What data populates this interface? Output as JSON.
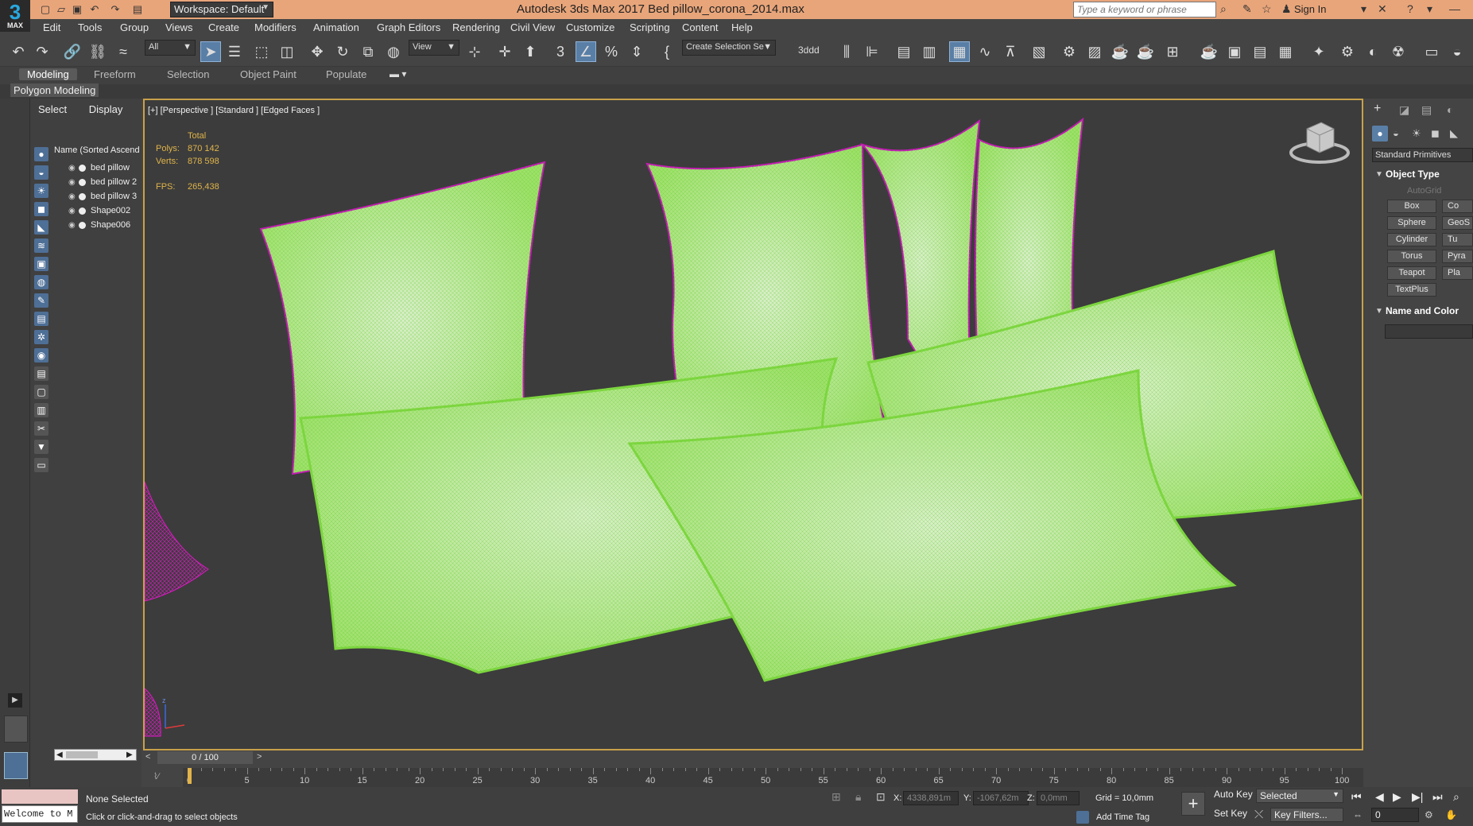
{
  "app": {
    "logo_text": "3",
    "logo_sub": "MAX",
    "title": "Autodesk 3ds Max 2017     Bed pillow_corona_2014.max",
    "workspace": "Workspace: Default",
    "search_placeholder": "Type a keyword or phrase",
    "sign_in": "Sign In"
  },
  "menu": [
    "Edit",
    "Tools",
    "Group",
    "Views",
    "Create",
    "Modifiers",
    "Animation",
    "Graph Editors",
    "Rendering",
    "Civil View",
    "Customize",
    "Scripting",
    "Content",
    "Help"
  ],
  "toolbar": {
    "filter": "All",
    "view_ref": "View",
    "selection_set": "Create Selection Se",
    "named": "3ddd"
  },
  "ribbon": {
    "tabs": [
      "Modeling",
      "Freeform",
      "Selection",
      "Object Paint",
      "Populate"
    ],
    "panel": "Polygon Modeling"
  },
  "scene_explorer": {
    "tabs": [
      "Select",
      "Display"
    ],
    "header": "Name (Sorted Ascend",
    "objects": [
      "bed pillow",
      "bed pillow 2",
      "bed pillow 3",
      "Shape002",
      "Shape006"
    ]
  },
  "viewport": {
    "label": "[+] [Perspective ] [Standard ] [Edged Faces ]",
    "stats_header": "Total",
    "polys_label": "Polys:",
    "polys": "870 142",
    "verts_label": "Verts:",
    "verts": "878 598",
    "fps_label": "FPS:",
    "fps": "265,438"
  },
  "command_panel": {
    "dropdown": "Standard Primitives",
    "object_type": "Object Type",
    "autogrid": "AutoGrid",
    "buttons_left": [
      "Box",
      "Sphere",
      "Cylinder",
      "Torus",
      "Teapot",
      "TextPlus"
    ],
    "buttons_right": [
      "Co",
      "GeoS",
      "Tu",
      "Pyra",
      "Pla"
    ],
    "name_and_color": "Name and Color"
  },
  "timeline": {
    "frame": "0 / 100",
    "ticks": [
      "0",
      "5",
      "10",
      "15",
      "20",
      "25",
      "30",
      "35",
      "40",
      "45",
      "50",
      "55",
      "60",
      "65",
      "70",
      "75",
      "80",
      "85",
      "90",
      "95",
      "100"
    ]
  },
  "status": {
    "welcome": "Welcome to M",
    "selection": "None Selected",
    "prompt": "Click or click-and-drag to select objects",
    "x_label": "X:",
    "x": "4338,891m",
    "y_label": "Y:",
    "y": "-1067,62m",
    "z_label": "Z:",
    "z": "0,0mm",
    "grid": "Grid = 10,0mm",
    "add_time_tag": "Add Time Tag",
    "auto_key": "Auto Key",
    "selected": "Selected",
    "set_key": "Set Key",
    "key_filters": "Key Filters...",
    "frame_value": "0"
  }
}
